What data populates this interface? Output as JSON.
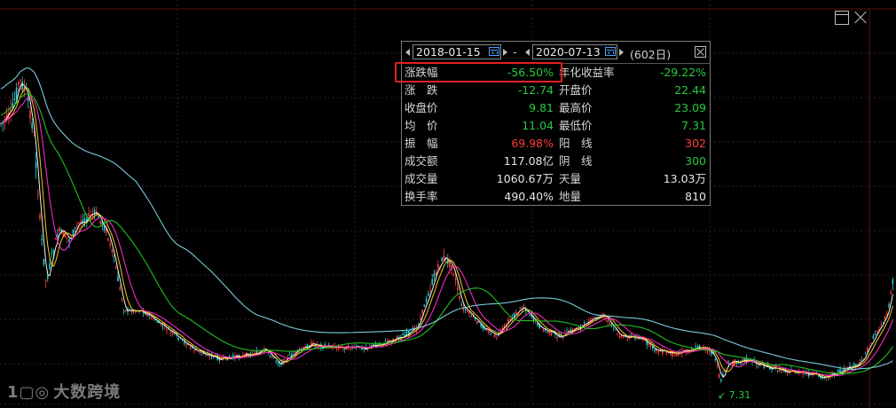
{
  "panel": {
    "start_date": "2018-01-15",
    "separator": "-",
    "end_date": "2020-07-13",
    "days": "(602日)",
    "rows": [
      {
        "label": "涨跌幅",
        "value": "-56.50%",
        "value_color": "green",
        "label2": "年化收益率",
        "value2": "-29.22%",
        "value2_color": "green"
      },
      {
        "label": "涨　跌",
        "value": "-12.74",
        "value_color": "green",
        "label2": "开盘价",
        "value2": "22.44",
        "value2_color": "green"
      },
      {
        "label": "收盘价",
        "value": "9.81",
        "value_color": "green",
        "label2": "最高价",
        "value2": "23.09",
        "value2_color": "green"
      },
      {
        "label": "均　价",
        "value": "11.04",
        "value_color": "green",
        "label2": "最低价",
        "value2": "7.31",
        "value2_color": "green"
      },
      {
        "label": "振　幅",
        "value": "69.98%",
        "value_color": "red",
        "label2": "阳　线",
        "value2": "302",
        "value2_color": "red"
      },
      {
        "label": "成交额",
        "value": "117.08亿",
        "value_color": "white",
        "label2": "阴　线",
        "value2": "300",
        "value2_color": "green"
      },
      {
        "label": "成交量",
        "value": "1060.67万",
        "value_color": "white",
        "label2": "天量",
        "value2": "13.03万",
        "value2_color": "white"
      },
      {
        "label": "换手率",
        "value": "490.40%",
        "value_color": "white",
        "label2": "地量",
        "value2": "810",
        "value2_color": "white"
      }
    ]
  },
  "chart": {
    "low_marker": "7.31",
    "background": "#000000",
    "grid_color": "#3a1a1a",
    "up_color": "#ff3b3b",
    "down_color": "#25d0d0",
    "ma_colors": [
      "#ffffff",
      "#ffd21e",
      "#ff2bd0",
      "#22c822",
      "#7fd6e6"
    ]
  },
  "watermark": {
    "logo": "1▢◎",
    "text": "大数跨境"
  },
  "icons": [
    "maximize-icon",
    "close-icon",
    "calendar-icon",
    "arrow-left-icon",
    "arrow-right-icon"
  ]
}
